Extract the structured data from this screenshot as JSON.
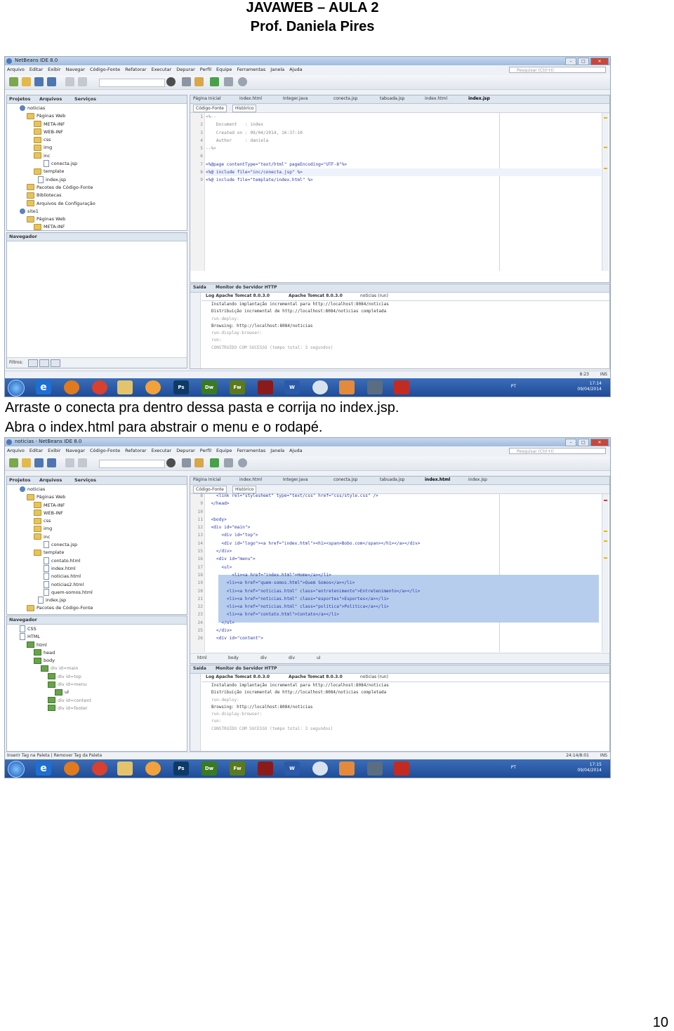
{
  "header": {
    "line1": "JAVAWEB – AULA 2",
    "line2": "Prof. Daniela Pires"
  },
  "captions": {
    "line1": "Arraste o conecta pra dentro dessa pasta e corrija no index.jsp.",
    "line2": "Abra o index.html para abstrair o menu e o rodapé."
  },
  "page_number": "10",
  "ide": {
    "menu": [
      "Arquivo",
      "Editar",
      "Exibir",
      "Navegar",
      "Código-Fonte",
      "Refatorar",
      "Executar",
      "Depurar",
      "Perfil",
      "Equipe",
      "Ferramentas",
      "Janela",
      "Ajuda"
    ],
    "search_placeholder": "Pesquisar (Ctrl+I)",
    "panel_tabs": {
      "projects": "Projetos",
      "files": "Arquivos",
      "services": "Serviços"
    },
    "editor_view_tabs": {
      "source": "Código-Fonte",
      "history": "Histórico"
    },
    "navigator_title": "Navegador",
    "output": {
      "title": "Saída",
      "http_monitor": "Monitor do Servidor HTTP",
      "tabs": [
        "Log Apache Tomcat 8.0.3.0",
        "Apache Tomcat 8.0.3.0",
        "noticias (run)"
      ],
      "lines": [
        "Instalando implantação incremental para http://localhost:8084/noticias",
        "Distribuição incremental de http://localhost:8084/noticias completada",
        "run-deploy:",
        "Browsing: http://localhost:8084/noticias",
        "run-display-browser:",
        "run:",
        "CONSTRUÍDO COM SUCESSO (tempo total: 3 segundos)"
      ]
    },
    "taskbar": {
      "lang": "PT"
    }
  },
  "shot1": {
    "title": "NetBeans IDE 8.0",
    "editor_tabs": [
      "Página Inicial",
      "index.html",
      "Integer.java",
      "conecta.jsp",
      "tabuada.jsp",
      "index.html",
      "index.jsp"
    ],
    "project_tree": [
      "noticias",
      "Páginas Web",
      "META-INF",
      "WEB-INF",
      "css",
      "img",
      "inc",
      "conecta.jsp",
      "template",
      "index.jsp",
      "Pacotes de Código-Fonte",
      "Bibliotecas",
      "Arquivos de Configuração",
      "site1",
      "Páginas Web",
      "META-INF"
    ],
    "code": [
      {
        "n": "1",
        "t": "<%--"
      },
      {
        "n": "2",
        "t": "    Document   : index"
      },
      {
        "n": "3",
        "t": "    Created on : 09/04/2014, 16:37:10"
      },
      {
        "n": "4",
        "t": "    Author     : daniela"
      },
      {
        "n": "5",
        "t": "--%>"
      },
      {
        "n": "6",
        "t": ""
      },
      {
        "n": "7",
        "t": "<%@page contentType=\"text/html\" pageEncoding=\"UTF-8\"%>"
      },
      {
        "n": "8",
        "t": "<%@ include file=\"inc/conecta.jsp\" %>"
      },
      {
        "n": "9",
        "t": "<%@ include file=\"template/index.html\" %>"
      }
    ],
    "filter_label": "Filtros:",
    "status_pos": "8:23",
    "status_ins": "INS",
    "clock": {
      "time": "17:14",
      "date": "09/04/2014"
    }
  },
  "shot2": {
    "title": "noticias - NetBeans IDE 8.0",
    "editor_tabs": [
      "Página Inicial",
      "index.html",
      "Integer.java",
      "conecta.jsp",
      "tabuada.jsp",
      "index.html",
      "index.jsp"
    ],
    "project_tree": [
      "noticias",
      "Páginas Web",
      "META-INF",
      "WEB-INF",
      "css",
      "img",
      "inc",
      "conecta.jsp",
      "template",
      "contato.html",
      "index.html",
      "noticias.html",
      "noticias2.html",
      "quem-somos.html",
      "index.jsp",
      "Pacotes de Código-Fonte"
    ],
    "navigator_tree": [
      "CSS",
      "HTML",
      "html",
      "head",
      "body",
      "div id=main",
      "div id=top",
      "div id=menu",
      "ul",
      "div id=content",
      "div id=footer"
    ],
    "code": [
      {
        "n": "8",
        "t": "    <link rel=\"stylesheet\" type=\"text/css\" href=\"css/style.css\" />"
      },
      {
        "n": "9",
        "t": "  </head>"
      },
      {
        "n": "10",
        "t": ""
      },
      {
        "n": "11",
        "t": "  <body>"
      },
      {
        "n": "12",
        "t": "  <div id=\"main\">"
      },
      {
        "n": "13",
        "t": "      <div id=\"top\">"
      },
      {
        "n": "14",
        "t": "      <div id=\"logo\"><a href=\"index.html\"><h1><span>Bobo.com</span></h1></a></div>"
      },
      {
        "n": "15",
        "t": "    </div>"
      },
      {
        "n": "16",
        "t": "    <div id=\"menu\">"
      },
      {
        "n": "17",
        "t": "      <ul>"
      },
      {
        "n": "18",
        "t": "          <li><a href=\"index.html\">Home</a></li>"
      },
      {
        "n": "19",
        "t": "        <li><a href=\"quem-somos.html\">Quem Somos</a></li>"
      },
      {
        "n": "20",
        "t": "        <li><a href=\"noticias.html\" class=\"entretenimento\">Entretenimento</a></li>"
      },
      {
        "n": "21",
        "t": "        <li><a href=\"noticias.html\" class=\"esportes\">Esportes</a></li>"
      },
      {
        "n": "22",
        "t": "        <li><a href=\"noticias.html\" class=\"politica\">Politica</a></li>"
      },
      {
        "n": "23",
        "t": "        <li><a href=\"contato.html\">Contato</a></li>"
      },
      {
        "n": "24",
        "t": "      </ul>"
      },
      {
        "n": "25",
        "t": "    </div>"
      },
      {
        "n": "26",
        "t": "    <div id=\"content\">"
      }
    ],
    "breadcrumb": [
      "html",
      "body",
      "div",
      "div",
      "ul"
    ],
    "status_left": "Inserir Tag na Paleta | Remover Tag da Paleta",
    "status_pos": "24:14/8:01",
    "status_ins": "INS",
    "clock": {
      "time": "17:15",
      "date": "09/04/2014"
    }
  }
}
